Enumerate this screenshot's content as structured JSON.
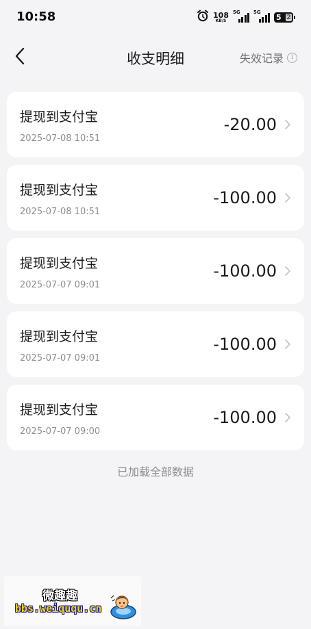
{
  "status_bar": {
    "time": "10:58",
    "net_speed_value": "108",
    "net_speed_unit": "KB/S",
    "sim1_network": "5G",
    "sim2_network": "5G",
    "battery_level": "52",
    "battery_tens": "5",
    "battery_ones": "2",
    "icons": [
      "alarm-icon",
      "signal-icon",
      "signal-icon",
      "battery-icon"
    ]
  },
  "nav": {
    "back_icon": "chevron-left-icon",
    "title": "收支明细",
    "right_link": "失效记录",
    "right_icon": "info-icon",
    "info_glyph": "i"
  },
  "records": [
    {
      "title": "提现到支付宝",
      "time": "2025-07-08 10:51",
      "amount": "-20.00"
    },
    {
      "title": "提现到支付宝",
      "time": "2025-07-08 10:51",
      "amount": "-100.00"
    },
    {
      "title": "提现到支付宝",
      "time": "2025-07-07 09:01",
      "amount": "-100.00"
    },
    {
      "title": "提现到支付宝",
      "time": "2025-07-07 09:01",
      "amount": "-100.00"
    },
    {
      "title": "提现到支付宝",
      "time": "2025-07-07 09:00",
      "amount": "-100.00"
    }
  ],
  "footer": "已加载全部数据",
  "watermark": {
    "title": "微趣趣",
    "url": "bbs.weiququ.cn"
  },
  "colors": {
    "background": "#f4f4f6",
    "card": "#ffffff",
    "primary_text": "#1c1c1e",
    "secondary_text": "#8e8e93"
  }
}
